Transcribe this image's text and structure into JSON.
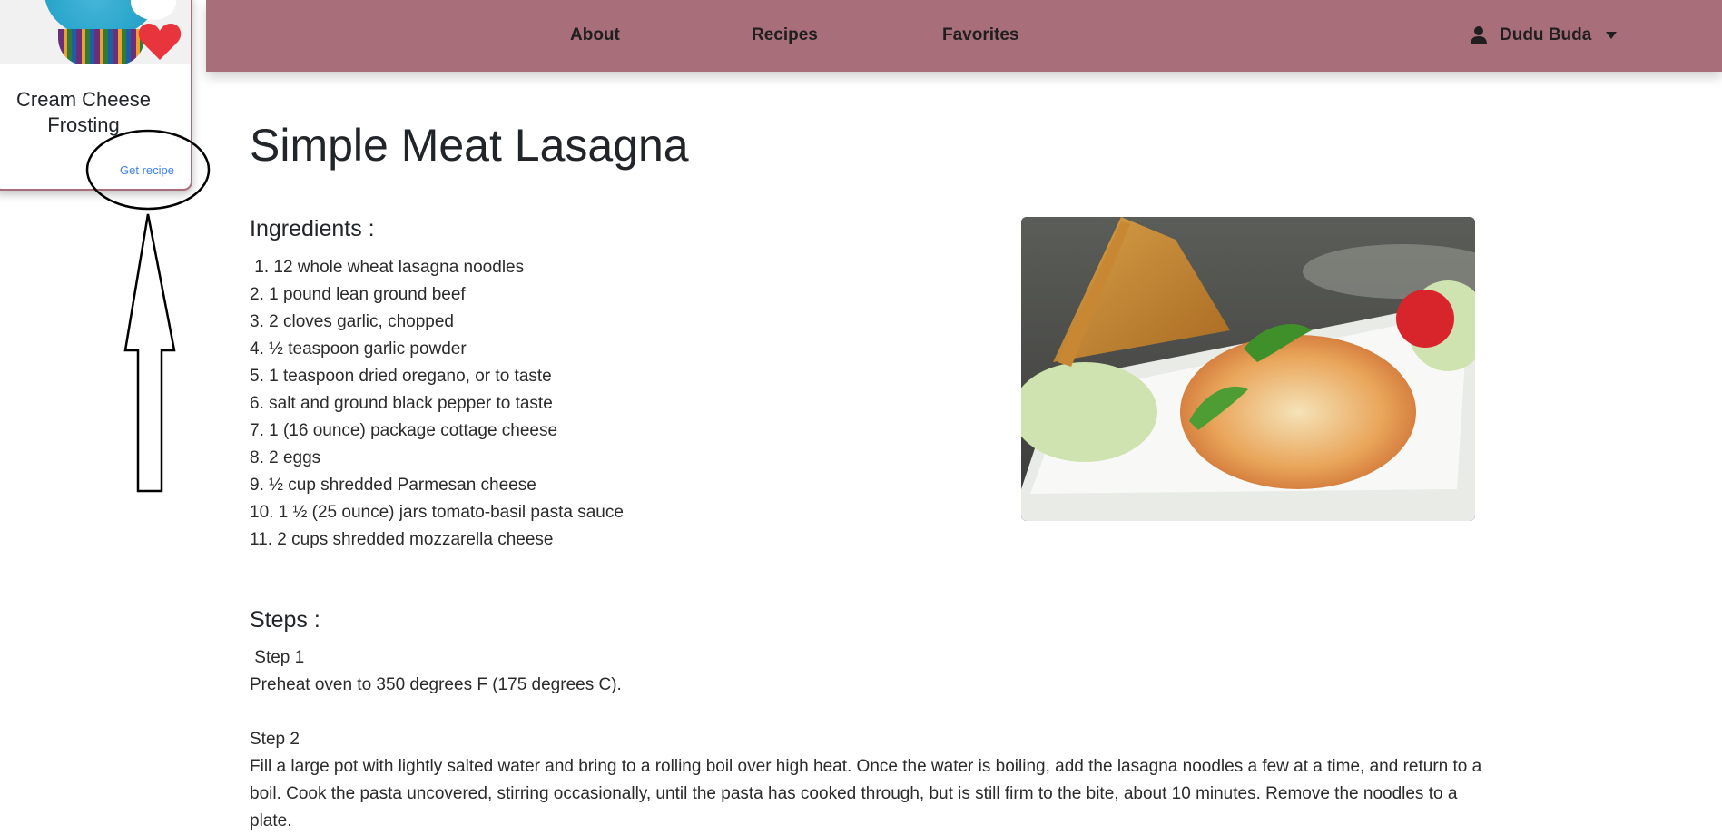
{
  "card": {
    "title": "Cream Cheese Frosting",
    "link_label": "Get recipe"
  },
  "nav": {
    "items": [
      {
        "label": "About"
      },
      {
        "label": "Recipes"
      },
      {
        "label": "Favorites"
      }
    ],
    "user_name": "Dudu Buda"
  },
  "recipe": {
    "title": "Simple Meat Lasagna",
    "ingredients_heading": "Ingredients :",
    "ingredients": [
      " 1. 12 whole wheat lasagna noodles",
      "2. 1 pound lean ground beef",
      "3. 2 cloves garlic, chopped",
      "4. ½ teaspoon garlic powder",
      "5. 1 teaspoon dried oregano, or to taste",
      "6. salt and ground black pepper to taste",
      "7. 1 (16 ounce) package cottage cheese",
      "8. 2 eggs",
      "9. ½ cup shredded Parmesan cheese",
      "10. 1 ½ (25 ounce) jars tomato-basil pasta sauce",
      "11. 2 cups shredded mozzarella cheese"
    ],
    "steps_heading": "Steps :",
    "steps": [
      {
        "label": " Step 1",
        "text": "Preheat oven to 350 degrees F (175 degrees C)."
      },
      {
        "label": "Step 2",
        "text": "Fill a large pot with lightly salted water and bring to a rolling boil over high heat. Once the water is boiling, add the lasagna noodles a few at a time, and return to a boil. Cook the pasta uncovered, stirring occasionally, until the pasta has cooked through, but is still firm to the bite, about 10 minutes. Remove the noodles to a plate."
      }
    ]
  },
  "colors": {
    "navbar": "#a86e79",
    "link": "#3b82f6",
    "heart": "#e8343c"
  },
  "icons": {
    "favorite": "heart-icon",
    "user": "user-icon",
    "dropdown": "caret-down-icon"
  }
}
